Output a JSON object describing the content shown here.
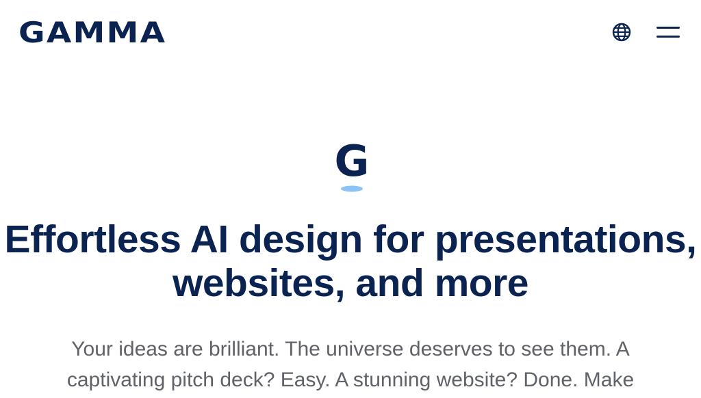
{
  "header": {
    "logo_text": "GAMMA",
    "language_icon": "globe-icon",
    "menu_icon": "hamburger-menu-icon"
  },
  "hero": {
    "mark_letter": "G",
    "headline": "Effortless AI design for presentations, websites, and more",
    "subtext": "Your ideas are brilliant. The universe deserves to see them. A captivating pitch deck? Easy. A stunning website? Done. Make"
  },
  "colors": {
    "brand_navy": "#0b2351",
    "accent_blue": "#8ec2f2",
    "body_text": "#5f6268"
  }
}
